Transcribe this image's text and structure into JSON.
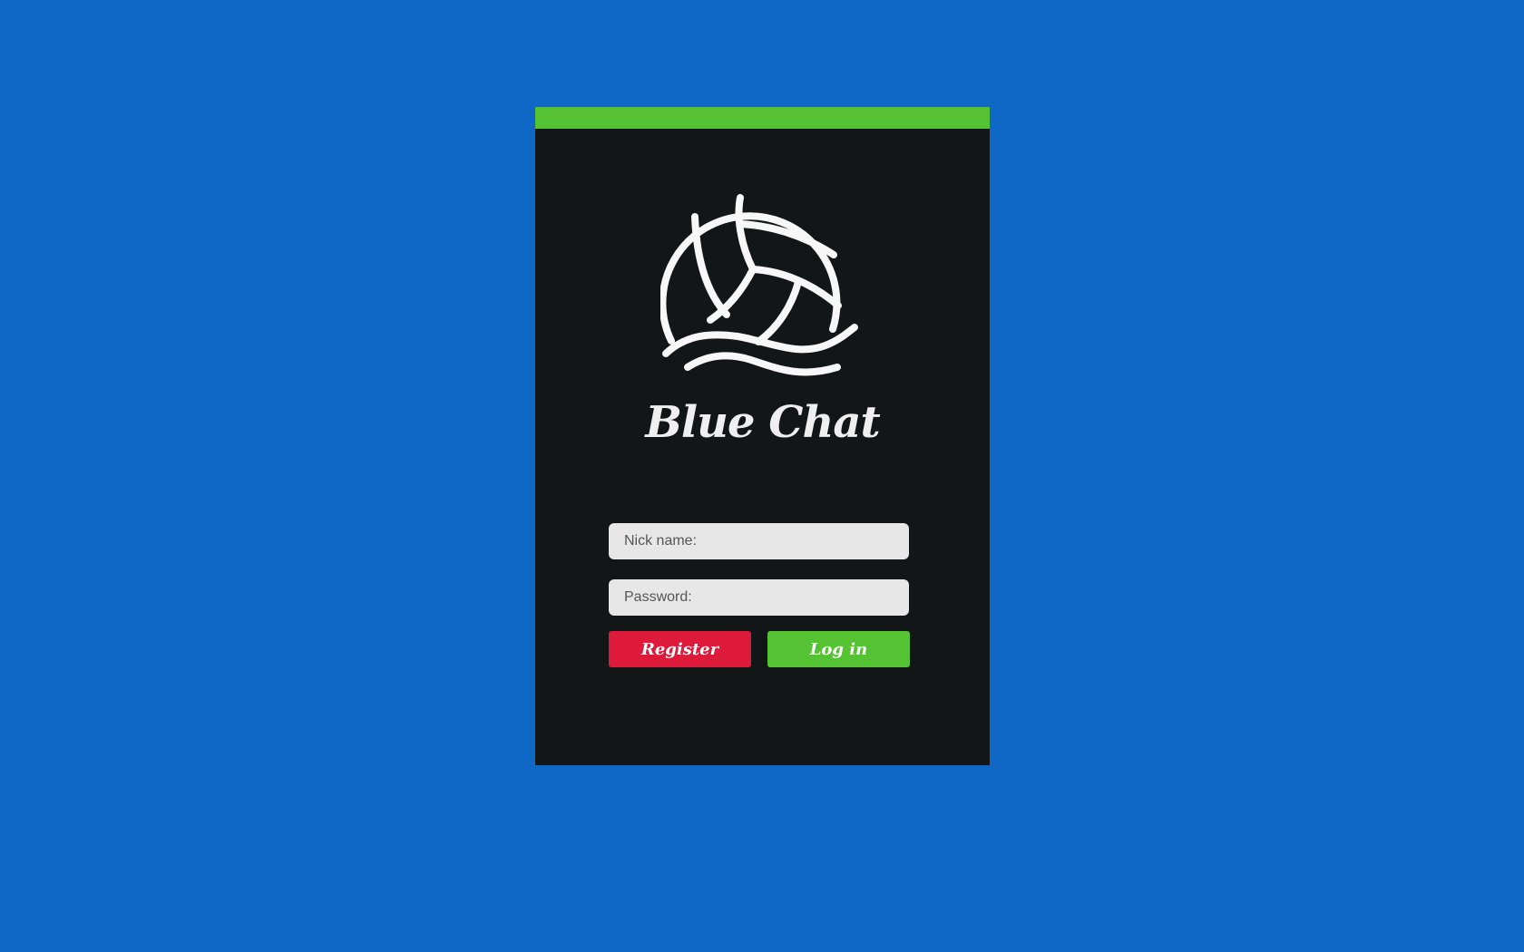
{
  "app": {
    "title": "Blue Chat",
    "logo_icon": "volleyball-wave-icon"
  },
  "colors": {
    "background": "#0f68c6",
    "card": "#131616",
    "accent_green": "#54c232",
    "register_red": "#de1a3a",
    "field_bg": "#e7e7e7"
  },
  "form": {
    "nickname": {
      "placeholder": "Nick name:",
      "value": ""
    },
    "password": {
      "placeholder": "Password:",
      "value": ""
    },
    "register_label": "Register",
    "login_label": "Log in"
  }
}
